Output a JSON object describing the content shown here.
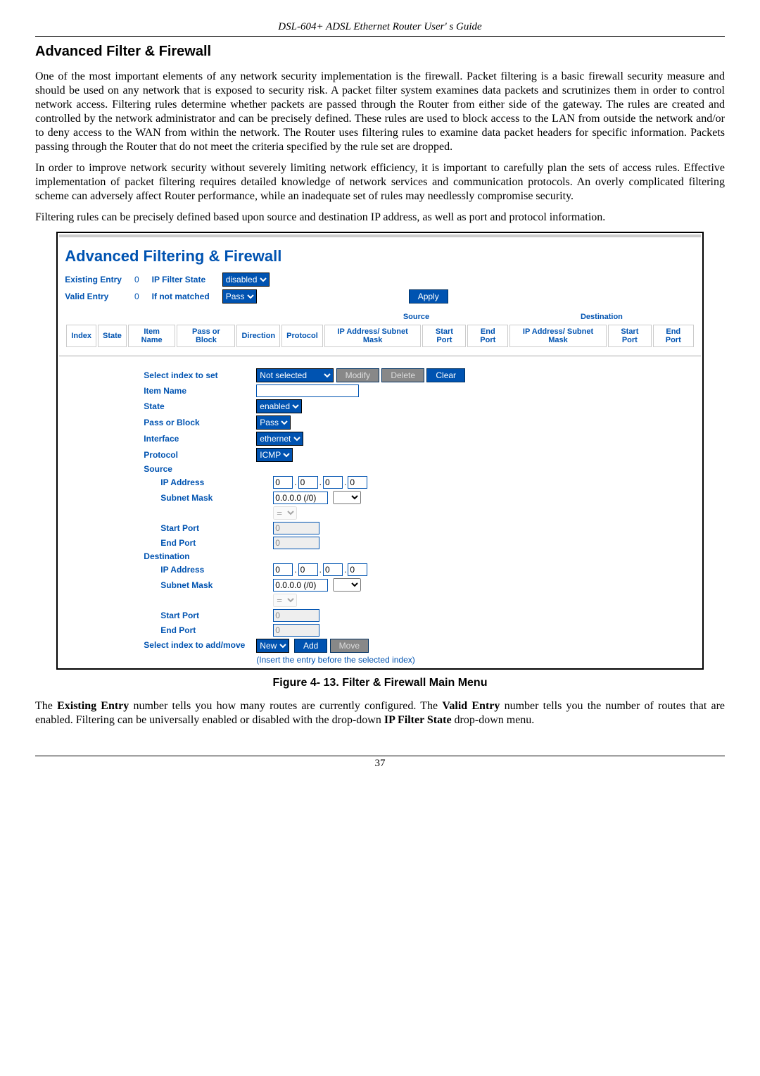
{
  "doc": {
    "header": "DSL-604+ ADSL Ethernet Router User' s Guide",
    "heading": "Advanced Filter & Firewall",
    "p1": "One of the most important elements of any network security implementation is the firewall. Packet filtering is a basic firewall security measure and should be used on any network that is exposed to security risk. A packet filter system examines data packets and scrutinizes them in order to control network access. Filtering rules determine whether packets are passed through the Router from either side of the gateway. The rules are created and controlled by the network administrator and can be precisely defined. These rules are used to block access to the LAN from outside the network and/or to deny access to the WAN from within the network. The Router uses filtering rules to examine data packet headers for specific information. Packets passing through the Router that do not meet the criteria specified by the rule set are dropped.",
    "p2": "In order to improve network security without severely limiting network efficiency, it is important to carefully plan the sets of access rules. Effective implementation of packet filtering requires detailed knowledge of network services and communication protocols. An overly complicated filtering scheme can adversely affect Router performance, while an inadequate set of rules may needlessly compromise security.",
    "p3": "Filtering rules can be precisely defined based upon source and destination IP address, as well as port and protocol information.",
    "fig_caption": "Figure 4- 13. Filter & Firewall Main Menu",
    "p4_a": "The ",
    "p4_b": "Existing Entry",
    "p4_c": " number tells you how many routes are currently configured. The ",
    "p4_d": "Valid Entry",
    "p4_e": " number tells you the number of routes that are enabled. Filtering can be universally enabled or disabled with the drop-down ",
    "p4_f": "IP Filter State",
    "p4_g": " drop-down menu.",
    "page_num": "37"
  },
  "ui": {
    "title": "Advanced Filtering & Firewall",
    "existing_entry_label": "Existing Entry",
    "existing_entry_value": "0",
    "ip_filter_state_label": "IP Filter State",
    "ip_filter_state_value": "disabled",
    "valid_entry_label": "Valid Entry",
    "valid_entry_value": "0",
    "if_not_matched_label": "If not matched",
    "if_not_matched_value": "Pass",
    "apply_btn": "Apply",
    "grid": {
      "src_group": "Source",
      "dest_group": "Destination",
      "index": "Index",
      "state": "State",
      "item_name": "Item Name",
      "pass_block": "Pass or Block",
      "direction": "Direction",
      "protocol": "Protocol",
      "ip_sub": "IP Address/ Subnet Mask",
      "start_port": "Start Port",
      "end_port": "End Port",
      "ip_sub2": "IP Address/ Subnet Mask",
      "start_port2": "Start Port",
      "end_port2": "End Port"
    },
    "set": {
      "select_index_label": "Select index to set",
      "select_index_value": "Not selected",
      "modify_btn": "Modify",
      "delete_btn": "Delete",
      "clear_btn": "Clear",
      "item_name_label": "Item Name",
      "item_name_value": "",
      "state_label": "State",
      "state_value": "enabled",
      "pass_block_label": "Pass or Block",
      "pass_block_value": "Pass",
      "interface_label": "Interface",
      "interface_value": "ethernet",
      "protocol_label": "Protocol",
      "protocol_value": "ICMP",
      "source_label": "Source",
      "dest_label": "Destination",
      "ip_address_label": "IP Address",
      "subnet_mask_label": "Subnet Mask",
      "subnet_mask_value": "0.0.0.0 (/0)",
      "eq_value": "=",
      "start_port_label": "Start Port",
      "end_port_label": "End Port",
      "port_value": "0",
      "ip_octet": "0",
      "sel_add_label": "Select index to add/move",
      "sel_add_value": "New",
      "add_btn": "Add",
      "move_btn": "Move",
      "insert_note": "(Insert the entry before the selected index)"
    }
  }
}
